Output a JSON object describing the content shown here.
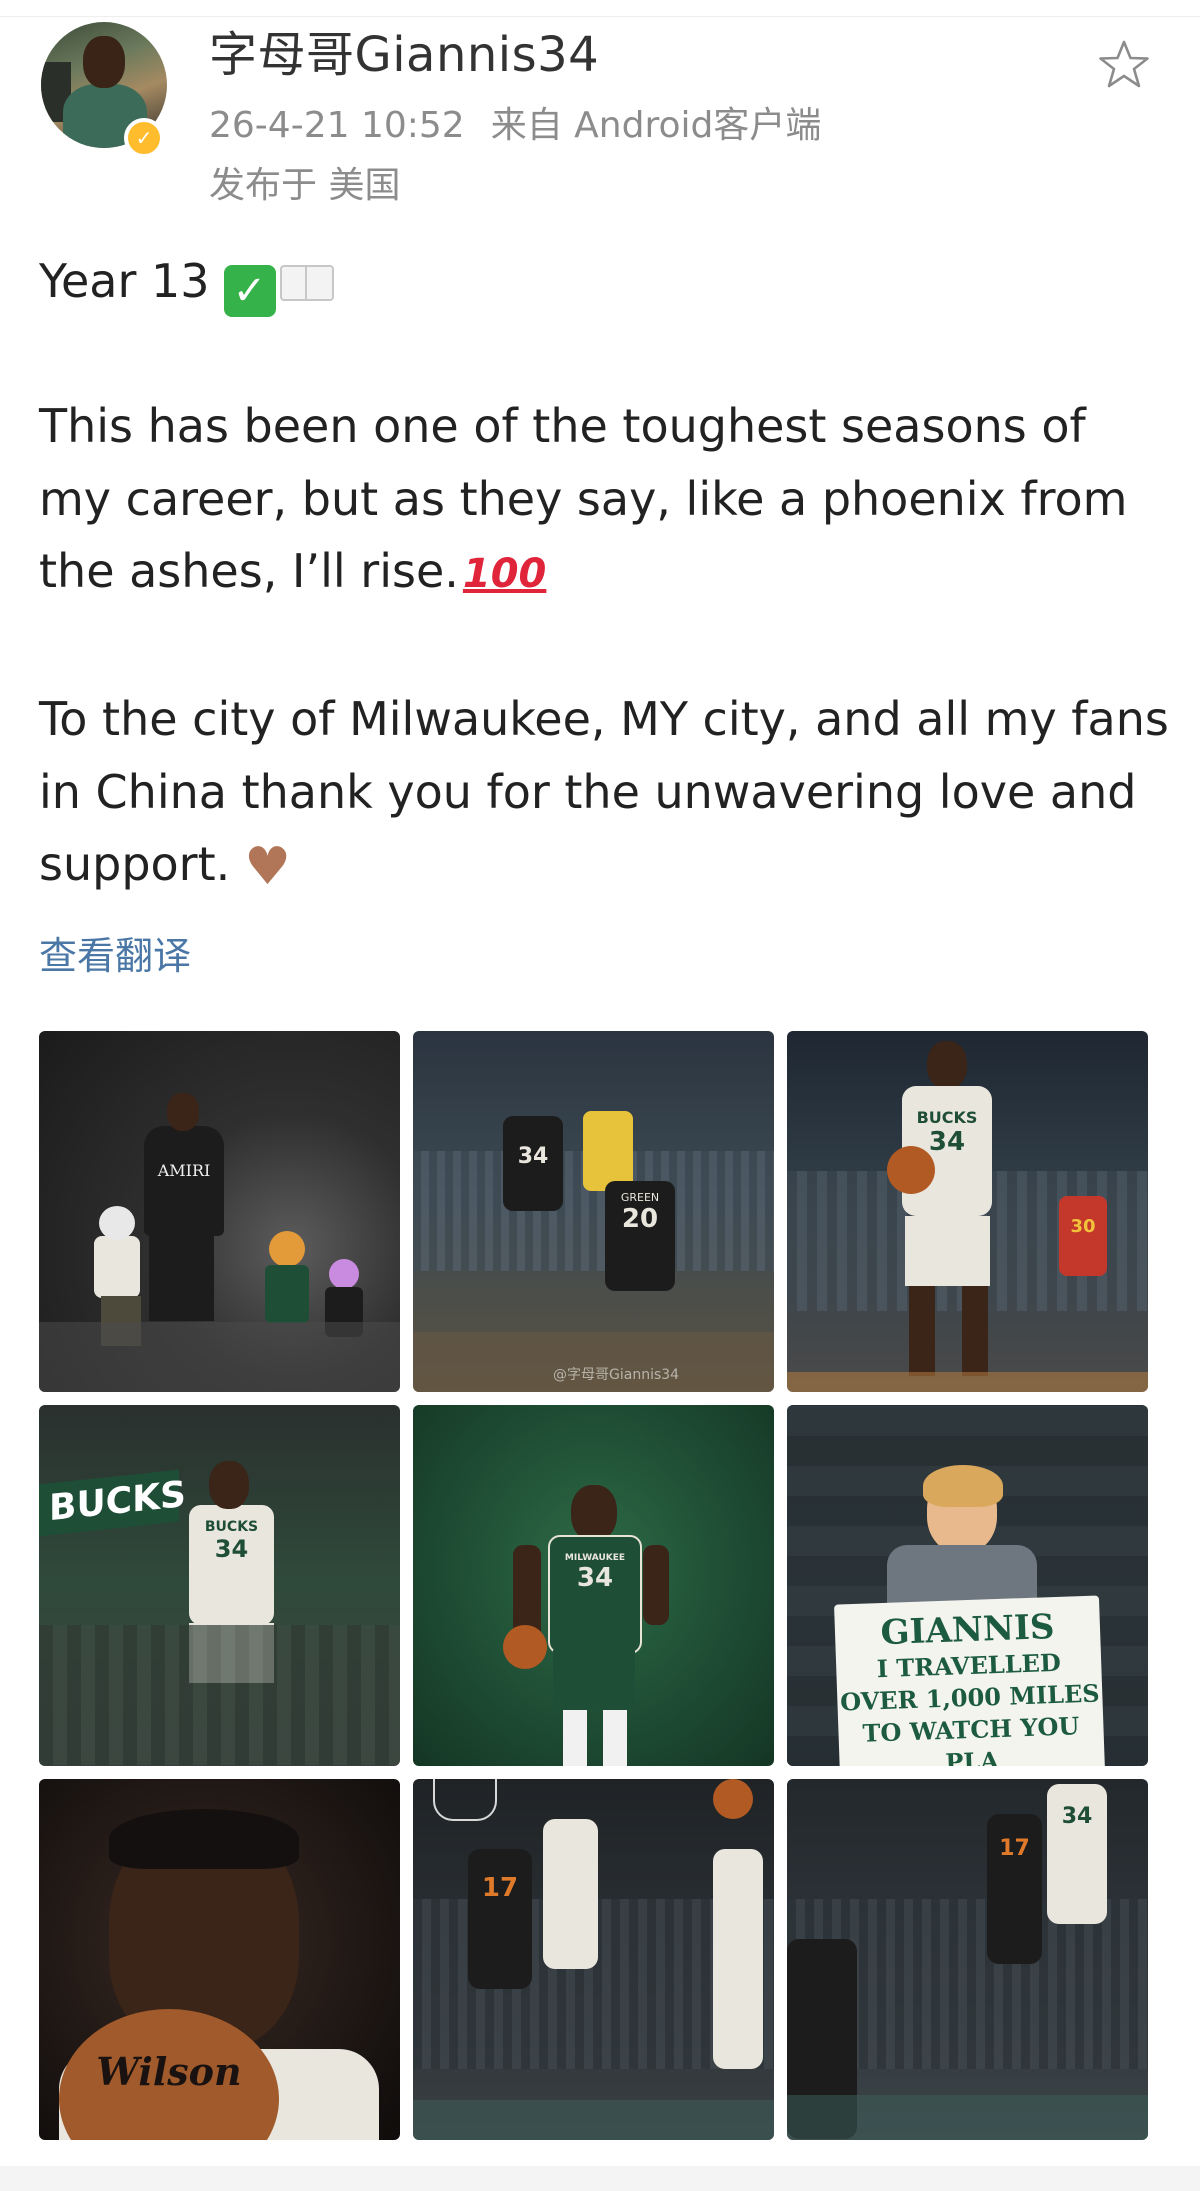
{
  "post": {
    "author": "字母哥Giannis34",
    "timestamp": "26-4-21 10:52",
    "source": "来自 Android客户端",
    "location": "发布于 美国",
    "paragraphs": {
      "p1": "Year 13",
      "p2": "This has been one of the toughest seasons of my career, but as they say, like a phoenix from the ashes, I’ll rise.",
      "p3": "To the city of Milwaukee, MY city, and all my fans in China  thank you for the unwavering love and support."
    },
    "emoji_100": "100",
    "translate_link": "查看翻译"
  },
  "images": {
    "t1_shirt": "AMIRI",
    "t2_watermark": "@字母哥Giannis34",
    "t2_num_a": "34",
    "t2_num_b": "20",
    "t2_name_b": "GREEN",
    "t3_team": "BUCKS",
    "t3_num": "34",
    "t3_num_opp": "30",
    "t4_banner": "BUCKS",
    "t4_team": "BUCKS",
    "t4_num": "34",
    "t5_team": "MILWAUKEE",
    "t5_num": "34",
    "t6_sign_line1": "GIANNIS",
    "t6_sign_line2": "I TRAVELLED",
    "t6_sign_line3": "OVER 1,000 MILES",
    "t6_sign_line4": "TO WATCH YOU PLA",
    "t7_ball": "Wilson",
    "t8_num": "17",
    "t9_num_a": "17",
    "t9_num_b": "34"
  },
  "colors": {
    "name": "#333333",
    "meta": "#8c8c8c",
    "body_text": "#222222",
    "link": "#4a77a6",
    "verified_badge": "#ffbd2e",
    "check_emoji": "#35b24a",
    "hundred_emoji": "#e0253a",
    "heart_emoji": "#b07657"
  },
  "icons": {
    "favorite": "star-outline-icon",
    "verified": "verified-badge-icon"
  }
}
